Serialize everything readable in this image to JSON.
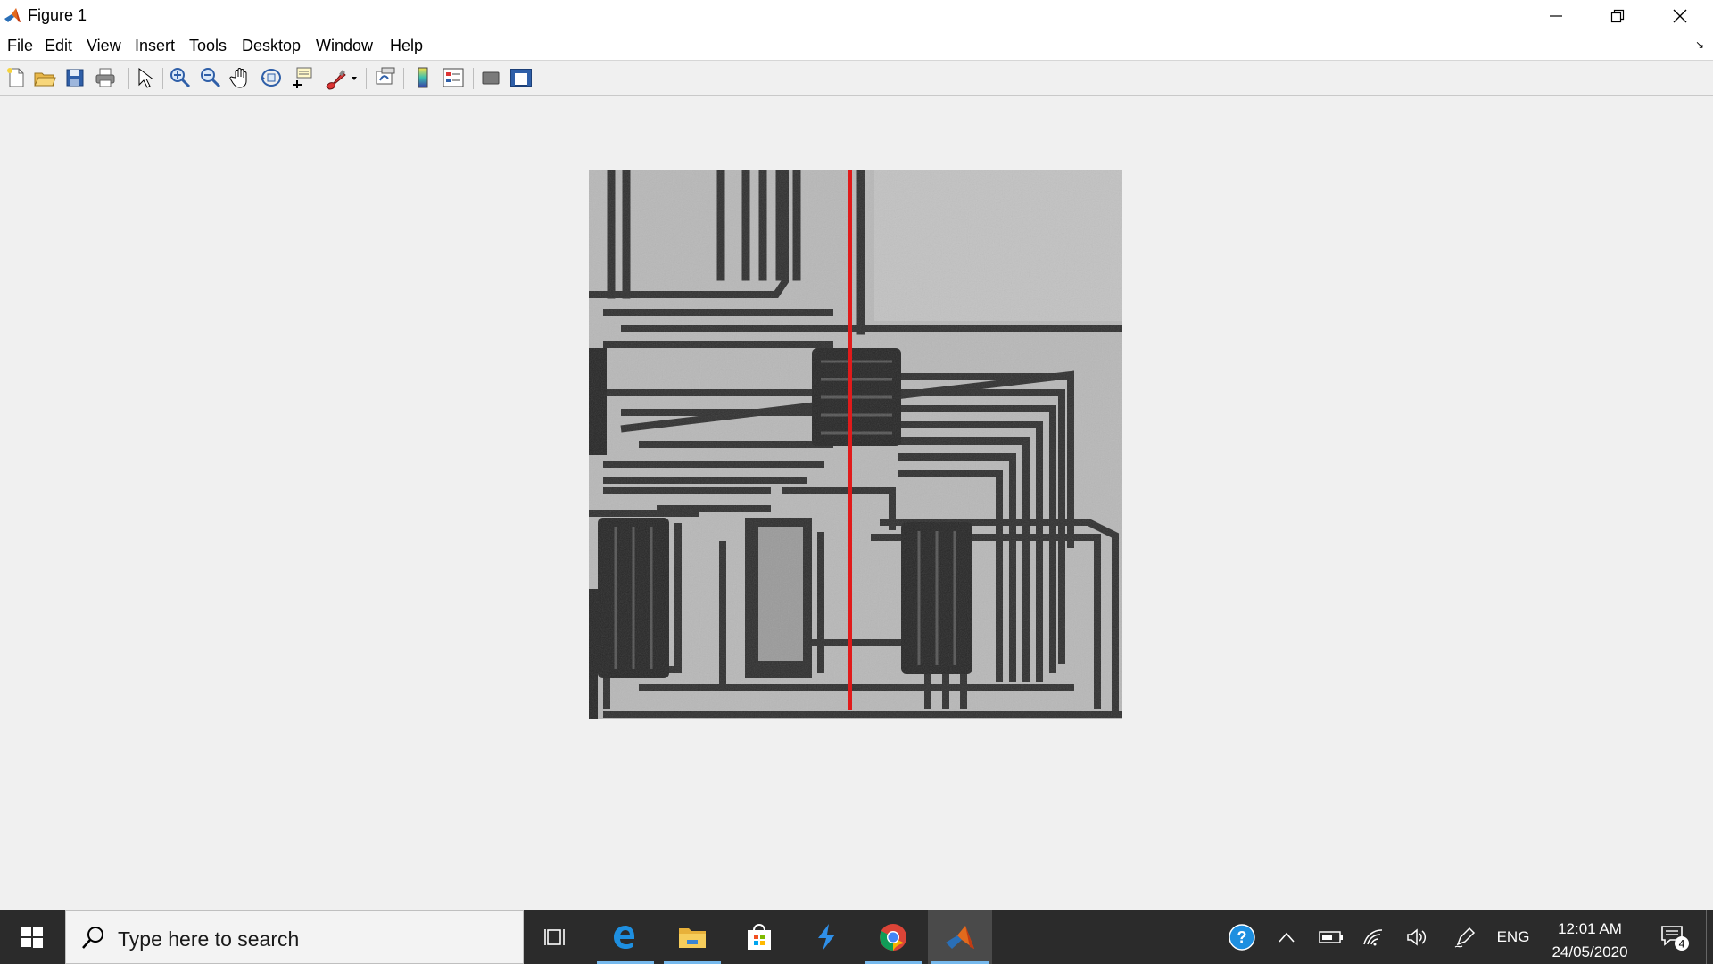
{
  "window": {
    "title": "Figure 1"
  },
  "menu": {
    "items": [
      "File",
      "Edit",
      "View",
      "Insert",
      "Tools",
      "Desktop",
      "Window",
      "Help"
    ]
  },
  "toolbar": {
    "buttons": [
      "new-figure-icon",
      "open-file-icon",
      "save-icon",
      "print-icon",
      "edit-plot-arrow-icon",
      "zoom-in-icon",
      "zoom-out-icon",
      "pan-hand-icon",
      "rotate-3d-icon",
      "data-cursor-icon",
      "brush-icon",
      "link-plot-icon",
      "colorbar-icon",
      "legend-icon",
      "hide-plot-tools-icon",
      "show-plot-tools-icon"
    ]
  },
  "figure": {
    "description_icon": "grayscale-microscope-circuit-image",
    "line_color": "#e01b1b"
  },
  "taskbar": {
    "search_placeholder": "Type here to search",
    "language": "ENG",
    "time": "12:01 AM",
    "date": "24/05/2020",
    "notification_count": "4"
  },
  "colors": {
    "taskbar_bg": "#2b2b2b",
    "window_bg": "#f0f0f0",
    "accent_indicator": "#76b9ed"
  }
}
